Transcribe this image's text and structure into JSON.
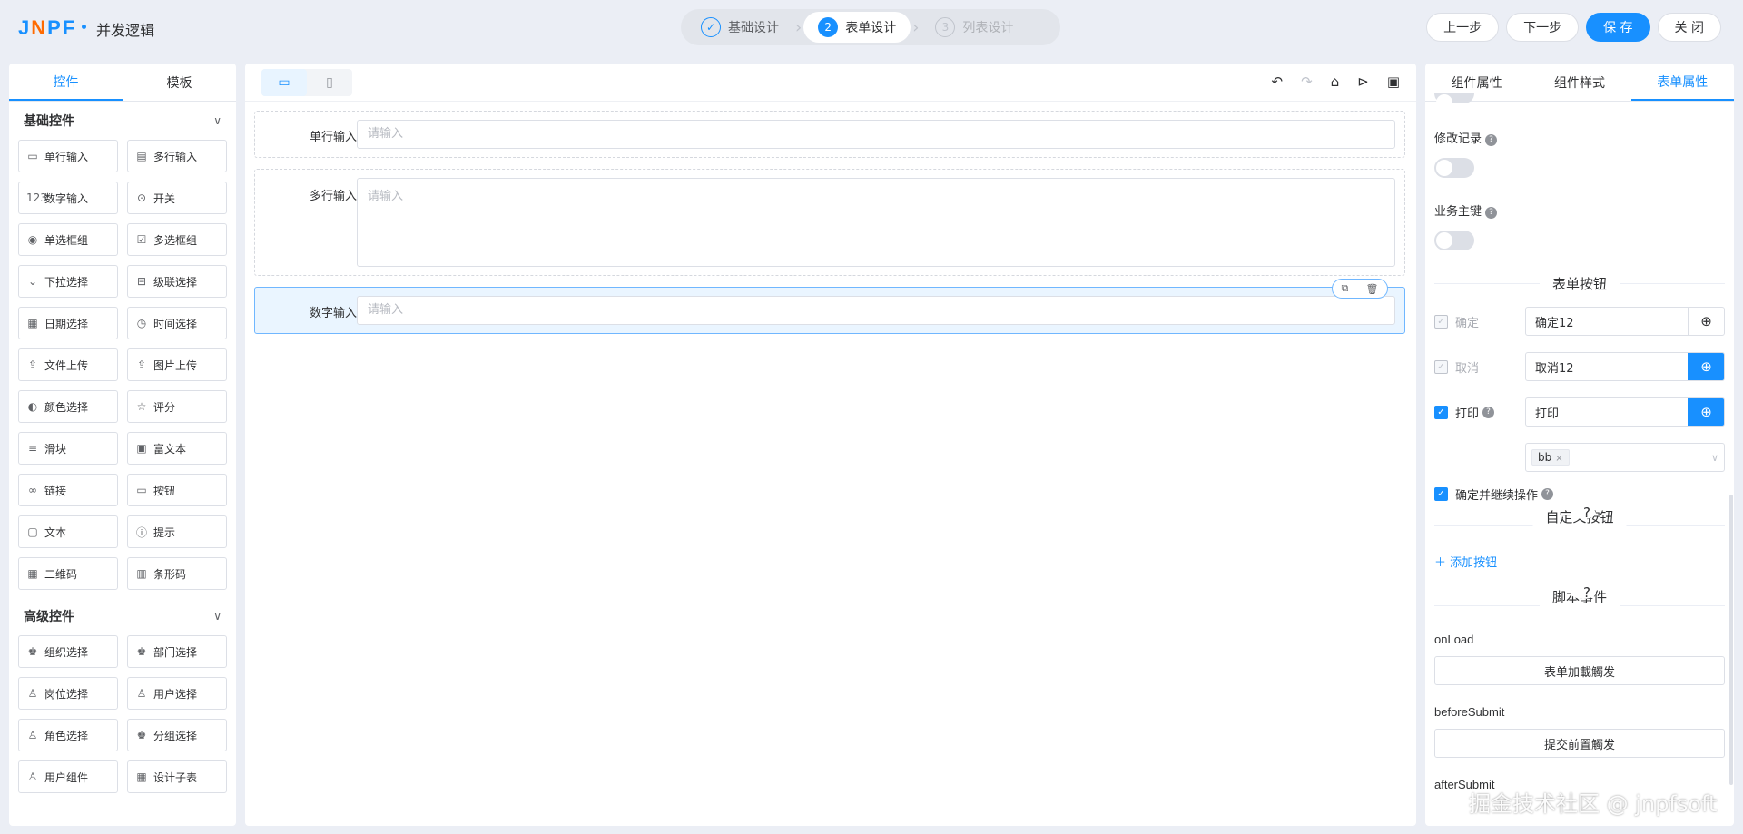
{
  "header": {
    "logo_text": "JNPF",
    "app_title": "并发逻辑",
    "steps": [
      {
        "num": "✓",
        "label": "基础设计"
      },
      {
        "num": "2",
        "label": "表单设计"
      },
      {
        "num": "3",
        "label": "列表设计"
      }
    ],
    "actions": {
      "prev": "上一步",
      "next": "下一步",
      "save": "保 存",
      "close": "关 闭"
    }
  },
  "left_panel": {
    "tabs": [
      "控件",
      "模板"
    ],
    "basic_title": "基础控件",
    "basic_items": [
      {
        "icon": "▭",
        "label": "单行输入"
      },
      {
        "icon": "▤",
        "label": "多行输入"
      },
      {
        "icon": "123",
        "label": "数字输入"
      },
      {
        "icon": "⊙",
        "label": "开关"
      },
      {
        "icon": "◉",
        "label": "单选框组"
      },
      {
        "icon": "☑",
        "label": "多选框组"
      },
      {
        "icon": "⌄",
        "label": "下拉选择"
      },
      {
        "icon": "⊟",
        "label": "级联选择"
      },
      {
        "icon": "▦",
        "label": "日期选择"
      },
      {
        "icon": "◷",
        "label": "时间选择"
      },
      {
        "icon": "⇪",
        "label": "文件上传"
      },
      {
        "icon": "⇪",
        "label": "图片上传"
      },
      {
        "icon": "◐",
        "label": "颜色选择"
      },
      {
        "icon": "☆",
        "label": "评分"
      },
      {
        "icon": "≡",
        "label": "滑块"
      },
      {
        "icon": "▣",
        "label": "富文本"
      },
      {
        "icon": "∞",
        "label": "链接"
      },
      {
        "icon": "▭",
        "label": "按钮"
      },
      {
        "icon": "▢",
        "label": "文本"
      },
      {
        "icon": "ⓘ",
        "label": "提示"
      },
      {
        "icon": "▦",
        "label": "二维码"
      },
      {
        "icon": "▥",
        "label": "条形码"
      }
    ],
    "advanced_title": "高级控件",
    "advanced_items": [
      {
        "icon": "♚",
        "label": "组织选择"
      },
      {
        "icon": "♚",
        "label": "部门选择"
      },
      {
        "icon": "♙",
        "label": "岗位选择"
      },
      {
        "icon": "♙",
        "label": "用户选择"
      },
      {
        "icon": "♙",
        "label": "角色选择"
      },
      {
        "icon": "♚",
        "label": "分组选择"
      },
      {
        "icon": "♙",
        "label": "用户组件"
      },
      {
        "icon": "▦",
        "label": "设计子表"
      }
    ]
  },
  "canvas": {
    "fields": [
      {
        "label": "单行输入",
        "placeholder": "请输入"
      },
      {
        "label": "多行输入",
        "placeholder": "请输入"
      },
      {
        "label": "数字输入",
        "placeholder": "请输入"
      }
    ]
  },
  "right_panel": {
    "tabs": [
      "组件属性",
      "组件样式",
      "表单属性"
    ],
    "edit_log_label": "修改记录",
    "biz_key_label": "业务主键",
    "form_buttons_title": "表单按钮",
    "confirm": {
      "label": "确定",
      "value": "确定12"
    },
    "cancel": {
      "label": "取消",
      "value": "取消12"
    },
    "print": {
      "label": "打印",
      "value": "打印"
    },
    "print_tag": "bb",
    "confirm_continue_label": "确定并继续操作",
    "custom_buttons_title": "自定义按钮",
    "add_button_label": "添加按钮",
    "script_events_title": "脚本事件",
    "events": [
      {
        "name": "onLoad",
        "button": "表单加載觸发"
      },
      {
        "name": "beforeSubmit",
        "button": "提交前置觸发"
      }
    ],
    "after_submit_label": "afterSubmit"
  },
  "watermark": "掘金技术社区 @ jnpfsoft"
}
